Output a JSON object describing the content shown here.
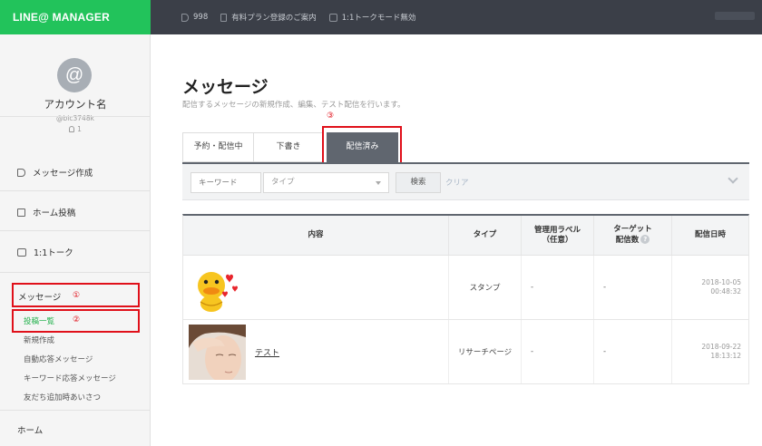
{
  "header": {
    "brand": "LINE@ MANAGER",
    "items": [
      {
        "icon": "speaker-icon",
        "label": "998"
      },
      {
        "icon": "document-icon",
        "label": "有料プラン登録のご案内"
      },
      {
        "icon": "chat-icon",
        "label": "1:1トークモード無効"
      }
    ]
  },
  "sidebar": {
    "avatar_symbol": "@",
    "account_name": "アカウント名",
    "account_id": "@bic3748k",
    "friend_count": "1",
    "menu": [
      {
        "label": "メッセージ作成",
        "icon": "speaker-icon"
      },
      {
        "label": "ホーム投稿",
        "icon": "pen-icon"
      },
      {
        "label": "1:1トーク",
        "icon": "chat-icon"
      }
    ],
    "section_label": "メッセージ",
    "section_marker": "①",
    "sub_items": [
      {
        "label": "投稿一覧",
        "marker": "②"
      },
      {
        "label": "新規作成"
      },
      {
        "label": "自動応答メッセージ"
      },
      {
        "label": "キーワード応答メッセージ"
      },
      {
        "label": "友だち追加時あいさつ"
      }
    ],
    "home_label": "ホーム"
  },
  "main": {
    "title": "メッセージ",
    "subtitle": "配信するメッセージの新規作成、編集、テスト配信を行います。",
    "tab_marker": "③",
    "tabs": [
      {
        "label": "予約・配信中"
      },
      {
        "label": "下書き"
      },
      {
        "label": "配信済み"
      }
    ],
    "filter": {
      "keyword_placeholder": "キーワード",
      "type_placeholder": "タイプ",
      "search_label": "検索",
      "clear_label": "クリア"
    },
    "table": {
      "headers": {
        "content": "内容",
        "type": "タイプ",
        "label_line1": "管理用ラベル",
        "label_line2": "（任意）",
        "target_line1": "ターゲット",
        "target_line2": "配信数",
        "date": "配信日時"
      },
      "rows": [
        {
          "content_title": "",
          "type": "スタンプ",
          "label": "-",
          "target": "-",
          "date_line1": "2018-10-05",
          "date_line2": "00:48:32"
        },
        {
          "content_title": "テスト",
          "type": "リサーチページ",
          "label": "-",
          "target": "-",
          "date_line1": "2018-09-22",
          "date_line2": "18:13:12"
        }
      ]
    }
  },
  "colors": {
    "brand_green": "#22c35b",
    "topbar": "#3b3f48",
    "active_tab": "#60666f",
    "annotation_red": "#e0101a",
    "active_sub": "#22b14c"
  }
}
